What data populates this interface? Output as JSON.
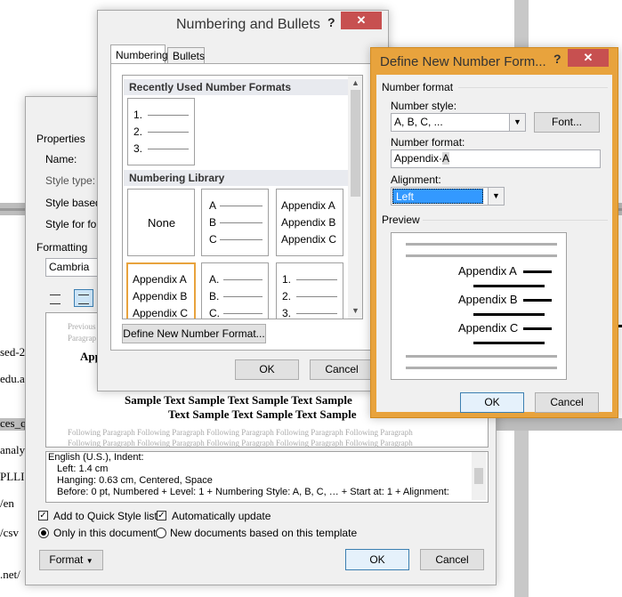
{
  "background_doc": {
    "fragments": [
      "sed-2",
      "edu.a",
      "ces_q",
      "analy",
      "PLLI",
      "/en",
      "/csv",
      ".net/"
    ]
  },
  "modify_style": {
    "properties_label": "Properties",
    "name_label": "Name:",
    "style_type_label": "Style type:",
    "style_based_label": "Style based",
    "style_follow_label": "Style for foll",
    "formatting_label": "Formatting",
    "font_value": "Cambria",
    "preview": {
      "previous_text": "Previous",
      "paragraph_text": "Paragrap",
      "appendix_text": "App",
      "sample_line1": "Sample Text Sample Text Sample Text Sample",
      "sample_line2": "Text Sample Text Sample Text Sample",
      "following_line": "Following Paragraph Following Paragraph Following Paragraph Following Paragraph Following Paragraph"
    },
    "description": {
      "line1": "English (U.S.), Indent:",
      "line2": "Left:  1.4 cm",
      "line3": "Hanging:  0.63 cm, Centered, Space",
      "line4": "Before:  0 pt, Numbered + Level: 1 + Numbering Style: A, B, C, … + Start at: 1 + Alignment:"
    },
    "add_quick_style": "Add to Quick Style list",
    "auto_update": "Automatically update",
    "only_this_doc": "Only in this document",
    "new_docs_template": "New documents based on this template",
    "format_button": "Format",
    "ok": "OK",
    "cancel": "Cancel"
  },
  "numbering_bullets": {
    "title": "Numbering and Bullets",
    "help": "?",
    "close": "✕",
    "tabs": [
      "Numbering",
      "Bullets"
    ],
    "recently_used": "Recently Used Number Formats",
    "recent_items": [
      "1.",
      "2.",
      "3."
    ],
    "library_label": "Numbering Library",
    "none_label": "None",
    "cell_abc": [
      "A",
      "B",
      "C"
    ],
    "cell_appendix": [
      "Appendix A",
      "Appendix B",
      "Appendix C"
    ],
    "cell_appendix_sel": [
      "Appendix A",
      "Appendix B",
      "Appendix C"
    ],
    "cell_abc_dot": [
      "A.",
      "B.",
      "C."
    ],
    "cell_num": [
      "1.",
      "2.",
      "3."
    ],
    "define_button": "Define New Number Format...",
    "ok": "OK",
    "cancel": "Cancel"
  },
  "define_format": {
    "title": "Define New Number Form...",
    "help": "?",
    "close": "✕",
    "group_number_format": "Number format",
    "number_style_label": "Number style:",
    "number_style_value": "A, B, C, ...",
    "font_button": "Font...",
    "number_format_label": "Number format:",
    "number_format_prefix": "Appendix·",
    "number_format_code": "A",
    "alignment_label": "Alignment:",
    "alignment_value": "Left",
    "preview_label": "Preview",
    "preview_items": [
      "Appendix A",
      "Appendix B",
      "Appendix C"
    ],
    "ok": "OK",
    "cancel": "Cancel"
  }
}
